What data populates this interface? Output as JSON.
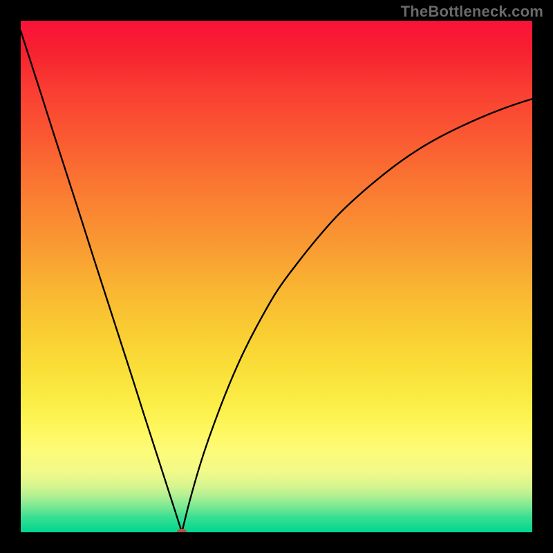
{
  "watermark": "TheBottleneck.com",
  "chart_data": {
    "type": "line",
    "title": "",
    "xlabel": "",
    "ylabel": "",
    "xlim": [
      0,
      100
    ],
    "ylim": [
      0,
      100
    ],
    "grid": false,
    "series": [
      {
        "name": "left-branch",
        "x": [
          0,
          2,
          4,
          6,
          8,
          10,
          12,
          14,
          16,
          18,
          20,
          22,
          24,
          26,
          28,
          30,
          31.5
        ],
        "y": [
          98,
          91.8,
          85.6,
          79.3,
          73.1,
          66.9,
          60.7,
          54.4,
          48.2,
          42.0,
          35.8,
          29.6,
          23.3,
          17.1,
          10.9,
          4.7,
          0
        ]
      },
      {
        "name": "right-branch",
        "x": [
          31.5,
          33,
          35,
          37,
          40,
          43,
          46,
          50,
          54,
          58,
          62,
          66,
          70,
          74,
          78,
          82,
          86,
          90,
          94,
          98,
          100
        ],
        "y": [
          0,
          6,
          13,
          19,
          27,
          34,
          40,
          47,
          52.5,
          57.5,
          62,
          65.8,
          69.2,
          72.3,
          75,
          77.3,
          79.3,
          81.1,
          82.7,
          84.1,
          84.7
        ]
      }
    ],
    "marker": {
      "x": 31.5,
      "y": 0,
      "color": "#b2553f"
    },
    "background_gradient": {
      "top": "#fa1239",
      "bottom": "#00d68f"
    }
  }
}
